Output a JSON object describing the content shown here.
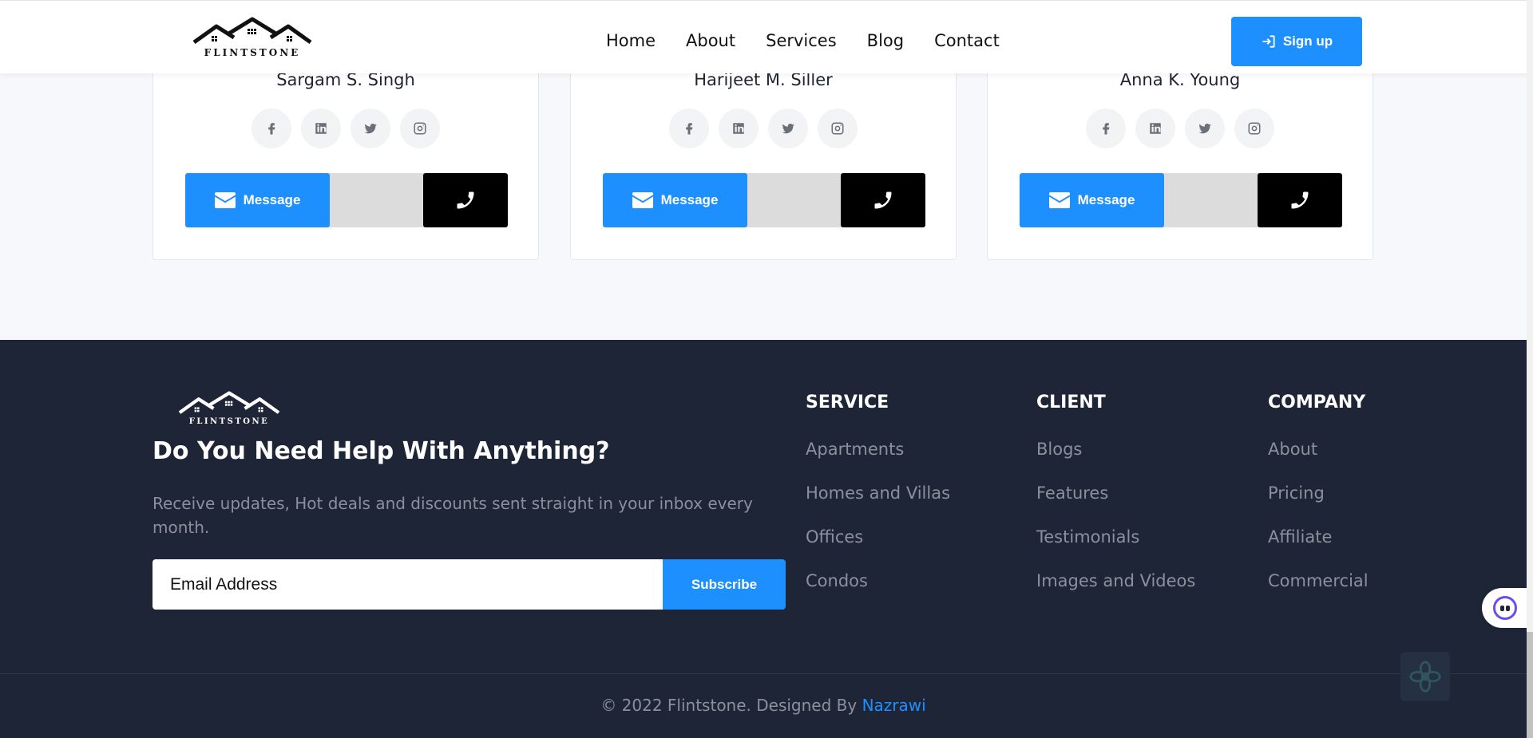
{
  "header": {
    "logo_text": "FLINTSTONE",
    "nav": [
      "Home",
      "About",
      "Services",
      "Blog",
      "Contact"
    ],
    "signup_label": "Sign up"
  },
  "agents": [
    {
      "name": "Sargam S. Singh",
      "message_label": "Message"
    },
    {
      "name": "Harijeet M. Siller",
      "message_label": "Message"
    },
    {
      "name": "Anna K. Young",
      "message_label": "Message"
    }
  ],
  "social_icons": [
    "facebook-icon",
    "linkedin-icon",
    "twitter-icon",
    "instagram-icon"
  ],
  "footer": {
    "logo_text": "FLINTSTONE",
    "help_title": "Do You Need Help With Anything?",
    "help_desc": "Receive updates, Hot deals and discounts sent straight in your inbox every month.",
    "email_placeholder": "Email Address",
    "subscribe_label": "Subscribe",
    "columns": [
      {
        "title": "SERVICE",
        "links": [
          "Apartments",
          "Homes and Villas",
          "Offices",
          "Condos"
        ]
      },
      {
        "title": "CLIENT",
        "links": [
          "Blogs",
          "Features",
          "Testimonials",
          "Images and Videos"
        ]
      },
      {
        "title": "COMPANY",
        "links": [
          "About",
          "Pricing",
          "Affiliate",
          "Commercial"
        ]
      }
    ],
    "copyright_prefix": "© 2022 Flintstone. Designed By ",
    "designer": "Nazrawi"
  },
  "colors": {
    "accent": "#1e8fff",
    "footer_bg": "#1e2536",
    "page_bg": "#f7f8fb"
  }
}
